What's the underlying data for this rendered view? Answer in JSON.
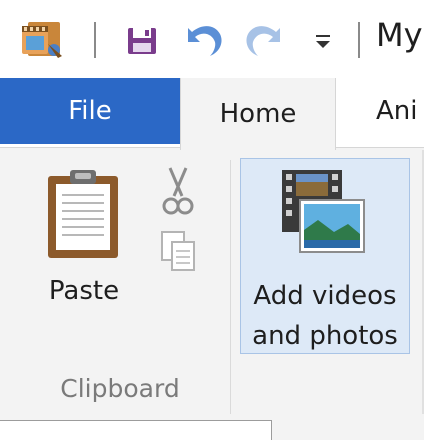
{
  "quick_access": {
    "app_icon": "movie-maker-app-icon",
    "save_icon": "save-icon",
    "undo_icon": "undo-icon",
    "redo_icon": "redo-icon",
    "customize_icon": "customize-dropdown-icon",
    "title": "My"
  },
  "tabs": {
    "file": "File",
    "home": "Home",
    "animations": "Ani"
  },
  "ribbon": {
    "clipboard": {
      "paste_label": "Paste",
      "cut_icon": "scissors-icon",
      "copy_icon": "copy-icon",
      "group_label": "Clipboard"
    },
    "add": {
      "label_line1": "Add videos",
      "label_line2": "and photos",
      "icon": "film-photo-icon"
    }
  },
  "colors": {
    "file_tab": "#2b68c6",
    "ribbon_bg": "#f3f3f3",
    "hover_bg": "#dde9f7",
    "hover_border": "#a9c4e6"
  }
}
